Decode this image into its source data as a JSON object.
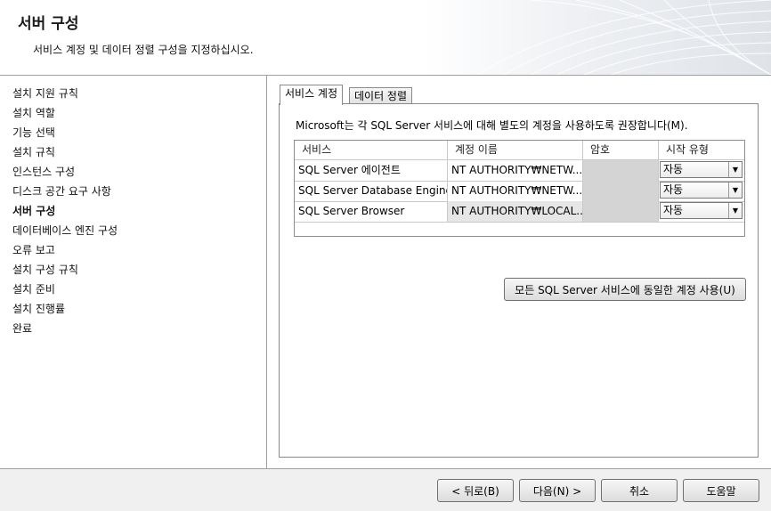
{
  "header": {
    "title": "서버 구성",
    "subtitle": "서비스 계정 및 데이터 정렬 구성을 지정하십시오."
  },
  "nav": {
    "items": [
      {
        "label": "설치 지원 규칙"
      },
      {
        "label": "설치 역할"
      },
      {
        "label": "기능 선택"
      },
      {
        "label": "설치 규칙"
      },
      {
        "label": "인스턴스 구성"
      },
      {
        "label": "디스크 공간 요구 사항"
      },
      {
        "label": "서버 구성",
        "active": true
      },
      {
        "label": "데이터베이스 엔진 구성"
      },
      {
        "label": "오류 보고"
      },
      {
        "label": "설치 구성 규칙"
      },
      {
        "label": "설치 준비"
      },
      {
        "label": "설치 진행률"
      },
      {
        "label": "완료"
      }
    ]
  },
  "tabs": [
    {
      "label": "서비스 계정",
      "selected": true
    },
    {
      "label": "데이터 정렬",
      "selected": false
    }
  ],
  "panel": {
    "intro": "Microsoft는 각 SQL Server 서비스에 대해 별도의 계정을 사용하도록 권장합니다(M).",
    "grid": {
      "headers": [
        "서비스",
        "계정 이름",
        "암호",
        "시작 유형"
      ],
      "rows": [
        {
          "service": "SQL Server 에이전트",
          "account": "NT AUTHORITY₩NETW...",
          "password": "",
          "startup": "자동"
        },
        {
          "service": "SQL Server Database Engine",
          "account": "NT AUTHORITY₩NETW...",
          "password": "",
          "startup": "자동"
        },
        {
          "service": "SQL Server Browser",
          "account": "NT AUTHORITY₩LOCAL...",
          "password": "",
          "startup": "자동"
        }
      ]
    },
    "same_account_button": "모든 SQL Server 서비스에 동일한 계정 사용(U)"
  },
  "footer": {
    "back": "< 뒤로(B)",
    "next": "다음(N) >",
    "cancel": "취소",
    "help": "도움말"
  },
  "icons": {
    "combo_arrow": "chevron-down-icon"
  }
}
